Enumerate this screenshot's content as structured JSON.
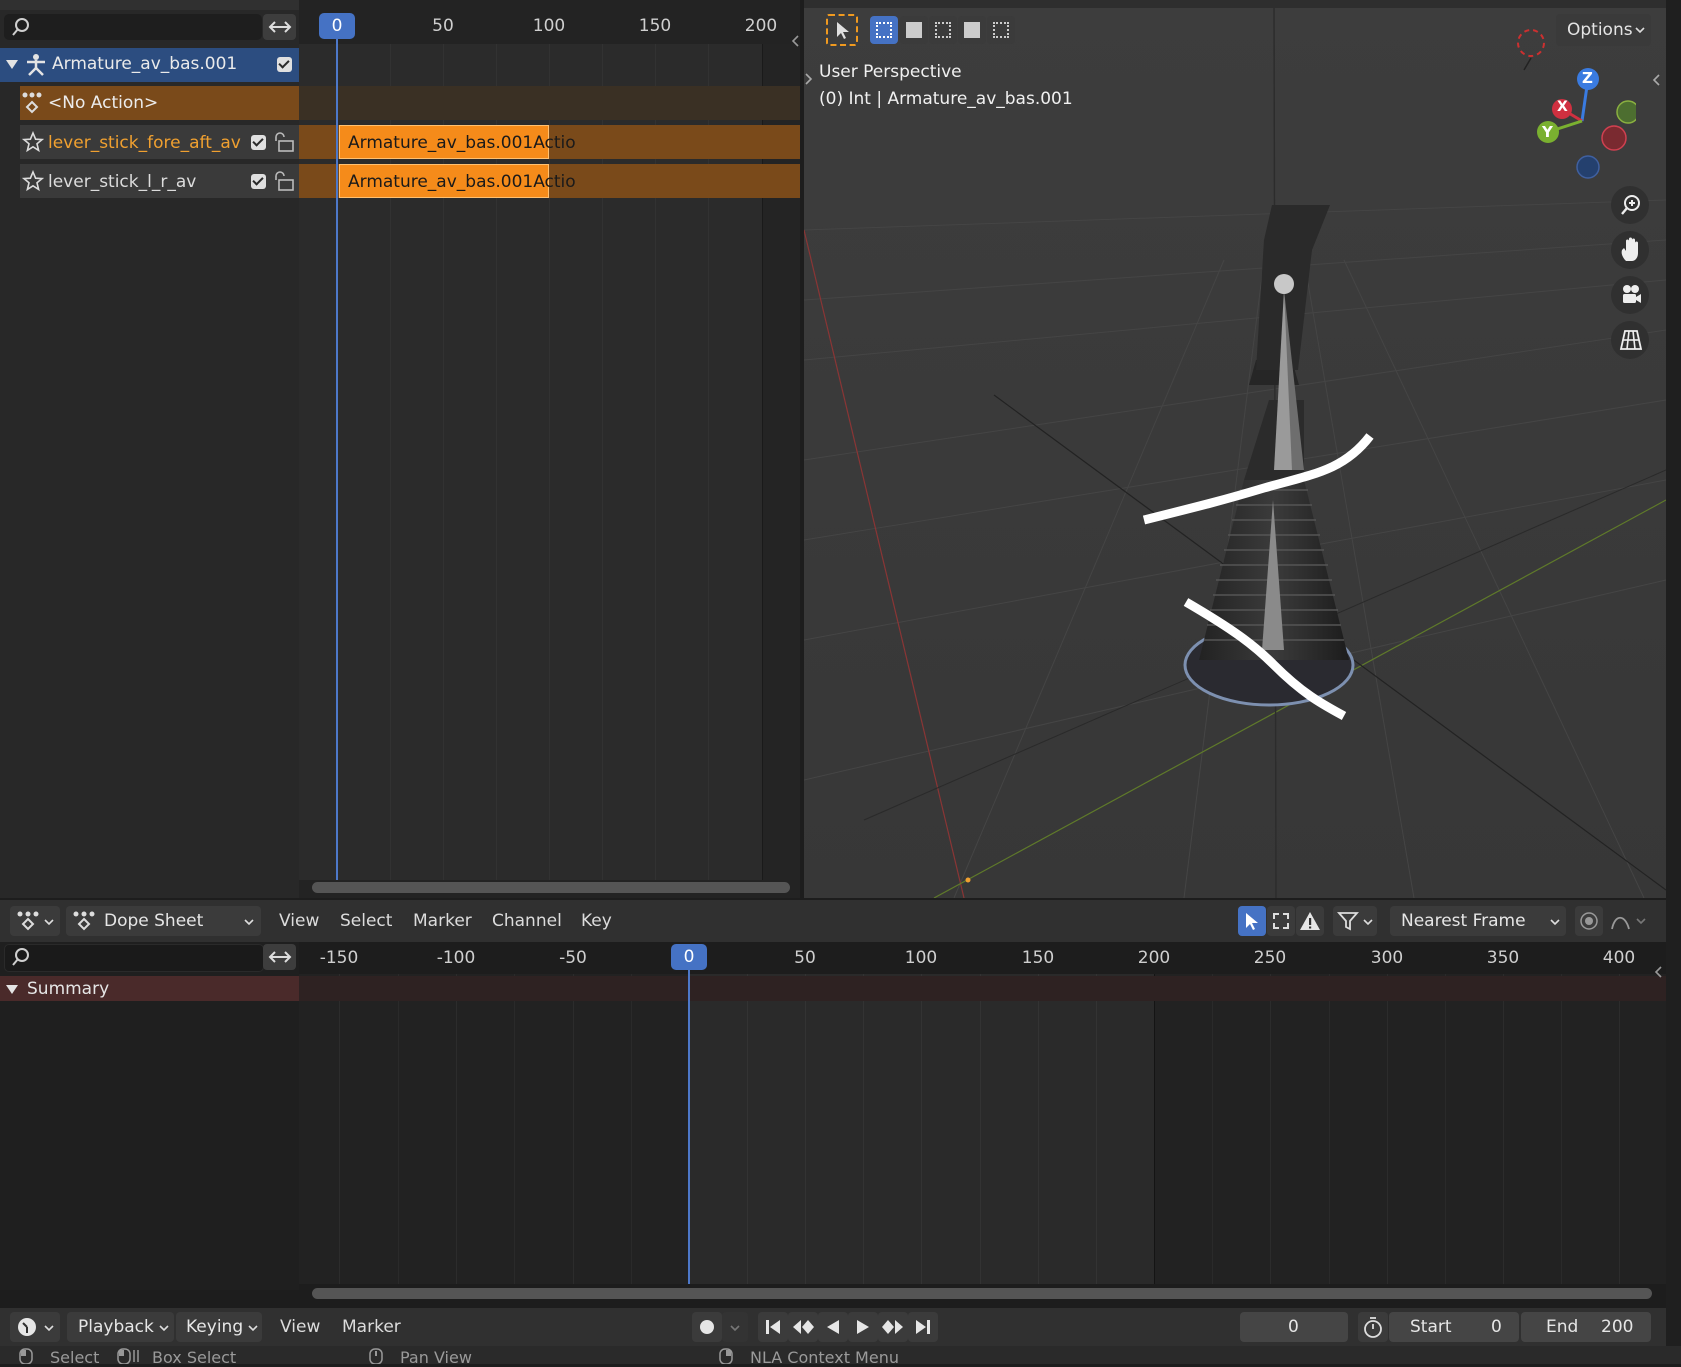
{
  "nla": {
    "ruler": [
      "0",
      "50",
      "100",
      "150",
      "200"
    ],
    "current_frame": "0",
    "tracks": [
      {
        "label": "Armature_av_bas.001",
        "type": "object"
      },
      {
        "label": "<No Action>",
        "type": "action"
      },
      {
        "label": "lever_stick_fore_aft_av",
        "type": "track",
        "strip": "Armature_av_bas.001Actio"
      },
      {
        "label": "lever_stick_l_r_av",
        "type": "track",
        "strip": "Armature_av_bas.001Actio"
      }
    ]
  },
  "viewport": {
    "title": "User Perspective",
    "subtitle": "(0) Int | Armature_av_bas.001",
    "options_label": "Options",
    "gizmo": {
      "z": "Z",
      "x": "X",
      "y": "Y"
    }
  },
  "dopesheet": {
    "editor_label": "Dope Sheet",
    "menus": [
      "View",
      "Select",
      "Marker",
      "Channel",
      "Key"
    ],
    "snap_label": "Nearest Frame",
    "ruler": [
      "-150",
      "-100",
      "-50",
      "0",
      "50",
      "100",
      "150",
      "200",
      "250",
      "300",
      "350",
      "400"
    ],
    "current_frame": "0",
    "summary_label": "Summary"
  },
  "timeline": {
    "menus": [
      "Playback",
      "Keying",
      "View",
      "Marker"
    ],
    "frame_value": "0",
    "start_label": "Start",
    "start_value": "0",
    "end_label": "End",
    "end_value": "200"
  },
  "statusbar": {
    "items": [
      "Select",
      "Box Select",
      "Pan View",
      "NLA Context Menu"
    ]
  },
  "colors": {
    "strip": "#f58b1a",
    "track_bg": "#7a4a1a",
    "accent": "#4572c4",
    "summary_bg": "#4a2a2a"
  }
}
